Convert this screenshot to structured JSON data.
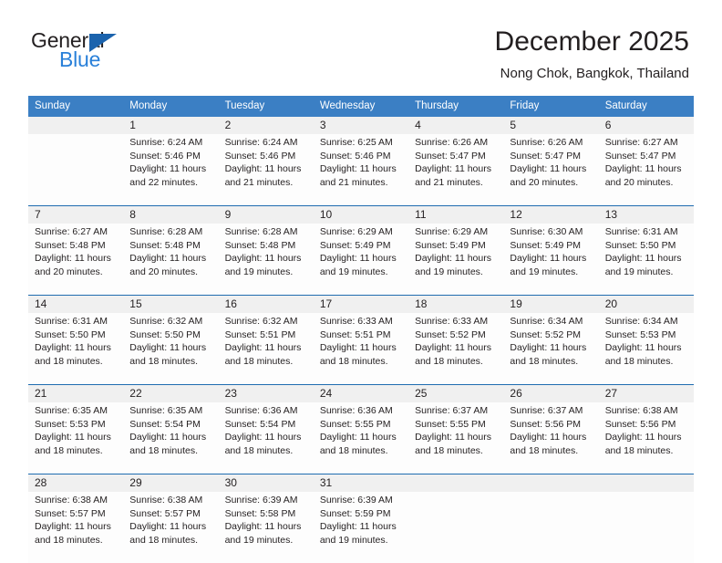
{
  "brand": {
    "name_top": "General",
    "name_bottom": "Blue",
    "accent_color": "#2980d9",
    "triangle_color": "#1b63ad"
  },
  "header": {
    "title": "December 2025",
    "subtitle": "Nong Chok, Bangkok, Thailand"
  },
  "theme": {
    "header_bg": "#3b7fc4",
    "date_band_bg": "#f0f0f0",
    "week_divider": "#1f6cb0",
    "text": "#231f20"
  },
  "weekday_headers": [
    "Sunday",
    "Monday",
    "Tuesday",
    "Wednesday",
    "Thursday",
    "Friday",
    "Saturday"
  ],
  "weeks": [
    {
      "days": [
        {
          "date": "",
          "sunrise": "",
          "sunset": "",
          "daylight": ""
        },
        {
          "date": "1",
          "sunrise": "Sunrise: 6:24 AM",
          "sunset": "Sunset: 5:46 PM",
          "daylight": "Daylight: 11 hours and 22 minutes."
        },
        {
          "date": "2",
          "sunrise": "Sunrise: 6:24 AM",
          "sunset": "Sunset: 5:46 PM",
          "daylight": "Daylight: 11 hours and 21 minutes."
        },
        {
          "date": "3",
          "sunrise": "Sunrise: 6:25 AM",
          "sunset": "Sunset: 5:46 PM",
          "daylight": "Daylight: 11 hours and 21 minutes."
        },
        {
          "date": "4",
          "sunrise": "Sunrise: 6:26 AM",
          "sunset": "Sunset: 5:47 PM",
          "daylight": "Daylight: 11 hours and 21 minutes."
        },
        {
          "date": "5",
          "sunrise": "Sunrise: 6:26 AM",
          "sunset": "Sunset: 5:47 PM",
          "daylight": "Daylight: 11 hours and 20 minutes."
        },
        {
          "date": "6",
          "sunrise": "Sunrise: 6:27 AM",
          "sunset": "Sunset: 5:47 PM",
          "daylight": "Daylight: 11 hours and 20 minutes."
        }
      ]
    },
    {
      "days": [
        {
          "date": "7",
          "sunrise": "Sunrise: 6:27 AM",
          "sunset": "Sunset: 5:48 PM",
          "daylight": "Daylight: 11 hours and 20 minutes."
        },
        {
          "date": "8",
          "sunrise": "Sunrise: 6:28 AM",
          "sunset": "Sunset: 5:48 PM",
          "daylight": "Daylight: 11 hours and 20 minutes."
        },
        {
          "date": "9",
          "sunrise": "Sunrise: 6:28 AM",
          "sunset": "Sunset: 5:48 PM",
          "daylight": "Daylight: 11 hours and 19 minutes."
        },
        {
          "date": "10",
          "sunrise": "Sunrise: 6:29 AM",
          "sunset": "Sunset: 5:49 PM",
          "daylight": "Daylight: 11 hours and 19 minutes."
        },
        {
          "date": "11",
          "sunrise": "Sunrise: 6:29 AM",
          "sunset": "Sunset: 5:49 PM",
          "daylight": "Daylight: 11 hours and 19 minutes."
        },
        {
          "date": "12",
          "sunrise": "Sunrise: 6:30 AM",
          "sunset": "Sunset: 5:49 PM",
          "daylight": "Daylight: 11 hours and 19 minutes."
        },
        {
          "date": "13",
          "sunrise": "Sunrise: 6:31 AM",
          "sunset": "Sunset: 5:50 PM",
          "daylight": "Daylight: 11 hours and 19 minutes."
        }
      ]
    },
    {
      "days": [
        {
          "date": "14",
          "sunrise": "Sunrise: 6:31 AM",
          "sunset": "Sunset: 5:50 PM",
          "daylight": "Daylight: 11 hours and 18 minutes."
        },
        {
          "date": "15",
          "sunrise": "Sunrise: 6:32 AM",
          "sunset": "Sunset: 5:50 PM",
          "daylight": "Daylight: 11 hours and 18 minutes."
        },
        {
          "date": "16",
          "sunrise": "Sunrise: 6:32 AM",
          "sunset": "Sunset: 5:51 PM",
          "daylight": "Daylight: 11 hours and 18 minutes."
        },
        {
          "date": "17",
          "sunrise": "Sunrise: 6:33 AM",
          "sunset": "Sunset: 5:51 PM",
          "daylight": "Daylight: 11 hours and 18 minutes."
        },
        {
          "date": "18",
          "sunrise": "Sunrise: 6:33 AM",
          "sunset": "Sunset: 5:52 PM",
          "daylight": "Daylight: 11 hours and 18 minutes."
        },
        {
          "date": "19",
          "sunrise": "Sunrise: 6:34 AM",
          "sunset": "Sunset: 5:52 PM",
          "daylight": "Daylight: 11 hours and 18 minutes."
        },
        {
          "date": "20",
          "sunrise": "Sunrise: 6:34 AM",
          "sunset": "Sunset: 5:53 PM",
          "daylight": "Daylight: 11 hours and 18 minutes."
        }
      ]
    },
    {
      "days": [
        {
          "date": "21",
          "sunrise": "Sunrise: 6:35 AM",
          "sunset": "Sunset: 5:53 PM",
          "daylight": "Daylight: 11 hours and 18 minutes."
        },
        {
          "date": "22",
          "sunrise": "Sunrise: 6:35 AM",
          "sunset": "Sunset: 5:54 PM",
          "daylight": "Daylight: 11 hours and 18 minutes."
        },
        {
          "date": "23",
          "sunrise": "Sunrise: 6:36 AM",
          "sunset": "Sunset: 5:54 PM",
          "daylight": "Daylight: 11 hours and 18 minutes."
        },
        {
          "date": "24",
          "sunrise": "Sunrise: 6:36 AM",
          "sunset": "Sunset: 5:55 PM",
          "daylight": "Daylight: 11 hours and 18 minutes."
        },
        {
          "date": "25",
          "sunrise": "Sunrise: 6:37 AM",
          "sunset": "Sunset: 5:55 PM",
          "daylight": "Daylight: 11 hours and 18 minutes."
        },
        {
          "date": "26",
          "sunrise": "Sunrise: 6:37 AM",
          "sunset": "Sunset: 5:56 PM",
          "daylight": "Daylight: 11 hours and 18 minutes."
        },
        {
          "date": "27",
          "sunrise": "Sunrise: 6:38 AM",
          "sunset": "Sunset: 5:56 PM",
          "daylight": "Daylight: 11 hours and 18 minutes."
        }
      ]
    },
    {
      "days": [
        {
          "date": "28",
          "sunrise": "Sunrise: 6:38 AM",
          "sunset": "Sunset: 5:57 PM",
          "daylight": "Daylight: 11 hours and 18 minutes."
        },
        {
          "date": "29",
          "sunrise": "Sunrise: 6:38 AM",
          "sunset": "Sunset: 5:57 PM",
          "daylight": "Daylight: 11 hours and 18 minutes."
        },
        {
          "date": "30",
          "sunrise": "Sunrise: 6:39 AM",
          "sunset": "Sunset: 5:58 PM",
          "daylight": "Daylight: 11 hours and 19 minutes."
        },
        {
          "date": "31",
          "sunrise": "Sunrise: 6:39 AM",
          "sunset": "Sunset: 5:59 PM",
          "daylight": "Daylight: 11 hours and 19 minutes."
        },
        {
          "date": "",
          "sunrise": "",
          "sunset": "",
          "daylight": ""
        },
        {
          "date": "",
          "sunrise": "",
          "sunset": "",
          "daylight": ""
        },
        {
          "date": "",
          "sunrise": "",
          "sunset": "",
          "daylight": ""
        }
      ]
    }
  ]
}
